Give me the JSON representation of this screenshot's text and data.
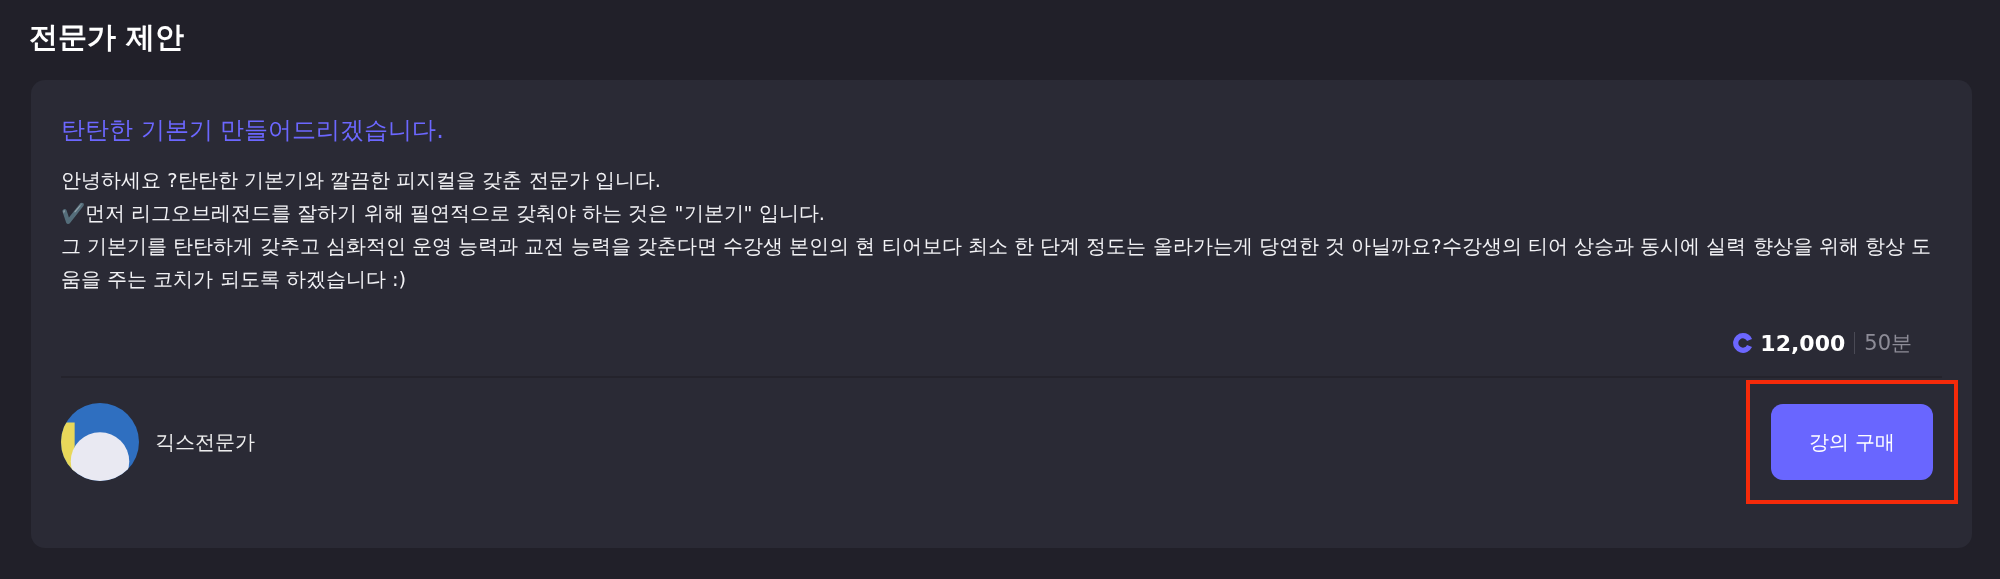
{
  "section_title": "전문가 제안",
  "offer": {
    "headline": "탄탄한 기본기 만들어드리겠습니다.",
    "body_lines": [
      "안녕하세요 ?탄탄한 기본기와 깔끔한 피지컬을 갖춘 전문가 입니다.",
      "✔️먼저 리그오브레전드를 잘하기 위해 필연적으로 갖춰야 하는 것은 \"기본기\" 입니다.",
      "그 기본기를 탄탄하게 갖추고 심화적인 운영 능력과 교전 능력을 갖춘다면 수강생 본인의 현 티어보다 최소 한 단계 정도는 올라가는게 당연한 것 아닐까요?수강생의 티어 상승과 동시에 실력 향상을 위해 항상 도움을 주는 코치가 되도록 하겠습니다 :)"
    ],
    "price": "12,000",
    "duration": "50분",
    "expert_name": "긱스전문가",
    "button": {
      "label": "강의 구매",
      "highlighted": true
    }
  }
}
